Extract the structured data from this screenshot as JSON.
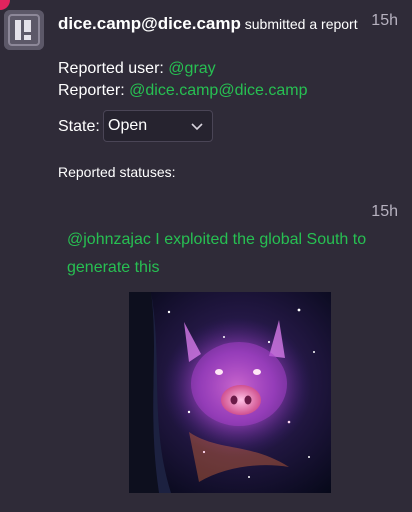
{
  "notification": {
    "account": "dice.camp@dice.camp",
    "action": "submitted a report",
    "time": "15h",
    "avatar_icon": "dice-camp-logo-icon"
  },
  "report": {
    "reported_user_label": "Reported user:",
    "reported_user": "@gray",
    "reporter_label": "Reporter:",
    "reporter": "@dice.camp@dice.camp",
    "state_label": "State:",
    "state_value": "Open",
    "statuses_heading": "Reported statuses:"
  },
  "status": {
    "time": "15h",
    "mention": "@johnzajac",
    "text": "I exploited the global South to generate this",
    "media_icon": "cosmic-pig-image"
  },
  "colors": {
    "background": "#2f2b38",
    "link": "#27c052",
    "muted": "#b6b1bf"
  }
}
